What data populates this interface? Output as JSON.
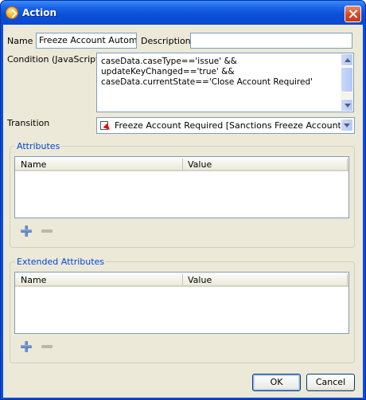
{
  "window": {
    "title": "Action"
  },
  "form": {
    "name_label": "Name",
    "name_value": "Freeze Account Automat",
    "description_label": "Description",
    "description_value": "",
    "condition_label": "Condition (JavaScript)",
    "condition_lines": [
      "caseData.caseType=='issue' &&",
      "updateKeyChanged=='true' &&",
      "caseData.currentState=='Close Account Required'"
    ],
    "transition_label": "Transition",
    "transition_value": "Freeze Account Required [Sanctions Freeze Account]"
  },
  "attributes": {
    "title": "Attributes",
    "columns": [
      "Name",
      "Value"
    ]
  },
  "extended_attributes": {
    "title": "Extended Attributes",
    "columns": [
      "Name",
      "Value"
    ]
  },
  "buttons": {
    "ok_label": "OK",
    "cancel_label": "Cancel"
  },
  "colors": {
    "title_bar": "#0a4fd6",
    "dialog_background": "#ece9d8",
    "group_title": "#0046d5",
    "close_button": "#d9481f"
  },
  "icons": {
    "window": "action-icon",
    "close": "close-icon",
    "transition": "transition-icon",
    "add": "plus-icon",
    "remove": "minus-icon"
  }
}
